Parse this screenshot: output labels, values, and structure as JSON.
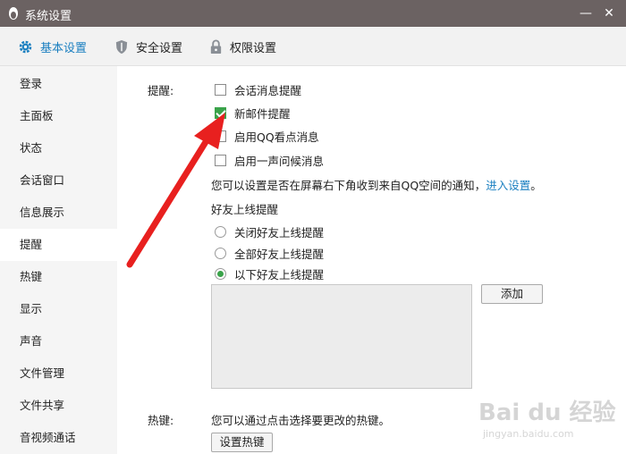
{
  "window": {
    "title": "系统设置",
    "minimize_glyph": "—",
    "close_glyph": "✕"
  },
  "tabs": [
    {
      "label": "基本设置",
      "icon": "gear-icon",
      "active": true
    },
    {
      "label": "安全设置",
      "icon": "shield-icon",
      "active": false
    },
    {
      "label": "权限设置",
      "icon": "lock-icon",
      "active": false
    }
  ],
  "sidebar": {
    "items": [
      {
        "label": "登录"
      },
      {
        "label": "主面板"
      },
      {
        "label": "状态"
      },
      {
        "label": "会话窗口"
      },
      {
        "label": "信息展示"
      },
      {
        "label": "提醒",
        "active": true
      },
      {
        "label": "热键"
      },
      {
        "label": "显示"
      },
      {
        "label": "声音"
      },
      {
        "label": "文件管理"
      },
      {
        "label": "文件共享"
      },
      {
        "label": "音视频通话"
      }
    ]
  },
  "reminders": {
    "section_label": "提醒:",
    "options": [
      {
        "label": "会话消息提醒",
        "checked": false
      },
      {
        "label": "新邮件提醒",
        "checked": true
      },
      {
        "label": "启用QQ看点消息",
        "checked": false
      },
      {
        "label": "启用一声问候消息",
        "checked": false
      }
    ],
    "notice_text": "您可以设置是否在屏幕右下角收到来自QQ空间的通知，",
    "notice_link": "进入设置",
    "notice_end": "。"
  },
  "friend_online": {
    "label": "好友上线提醒",
    "options": [
      {
        "label": "关闭好友上线提醒",
        "checked": false
      },
      {
        "label": "全部好友上线提醒",
        "checked": false
      },
      {
        "label": "以下好友上线提醒",
        "checked": true
      }
    ],
    "add_button": "添加"
  },
  "hotkeys": {
    "section_label": "热键:",
    "description": "您可以通过点击选择要更改的热键。",
    "button": "设置热键"
  },
  "watermark": {
    "logo": "Bai du 经验",
    "url": "jingyan.baidu.com"
  },
  "colors": {
    "titlebar": "#6b6262",
    "accent": "#1a7fc0",
    "check_green": "#3aa34a",
    "annotation_arrow": "#e8201f"
  }
}
